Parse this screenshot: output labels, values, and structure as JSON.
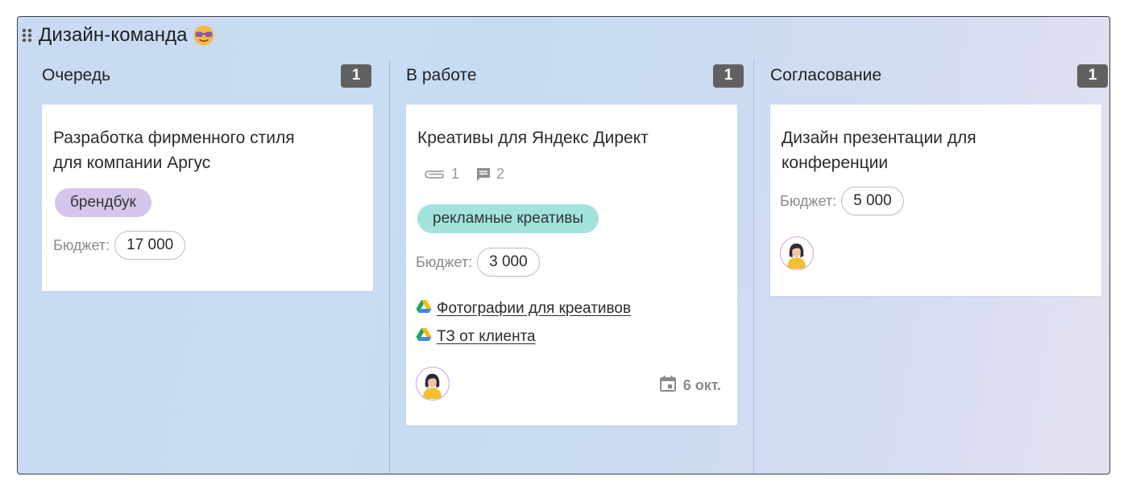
{
  "board": {
    "title": "Дизайн-команда",
    "icons": {
      "drag": "drag-handle-icon",
      "emoji": "sunglasses-face-emoji"
    }
  },
  "columns": [
    {
      "title": "Очередь",
      "count": "1",
      "cards": [
        {
          "title": "Разработка фирменного стиля для компании Аргус",
          "tag": {
            "label": "брендбук",
            "color": "#d5c7eb"
          },
          "budget_label": "Бюджет:",
          "budget_value": "17 000"
        }
      ]
    },
    {
      "title": "В работе",
      "count": "1",
      "cards": [
        {
          "title": "Креативы для Яндекс Директ",
          "attachments": "1",
          "comments": "2",
          "tag": {
            "label": "рекламные креативы",
            "color": "#a2e3de"
          },
          "budget_label": "Бюджет:",
          "budget_value": "3 000",
          "links": [
            {
              "label": "Фотографии для креативов",
              "icon": "google-drive-icon"
            },
            {
              "label": "ТЗ от клиента",
              "icon": "google-drive-icon"
            }
          ],
          "due_date": "6 окт."
        }
      ]
    },
    {
      "title": "Согласование",
      "count": "1",
      "cards": [
        {
          "title": "Дизайн презентации для конференции",
          "budget_label": "Бюджет:",
          "budget_value": "5 000"
        }
      ]
    }
  ],
  "colors": {
    "badge": "#616161",
    "drive_green": "#1ea362",
    "drive_yellow": "#ffba00",
    "drive_blue": "#4285f4"
  }
}
